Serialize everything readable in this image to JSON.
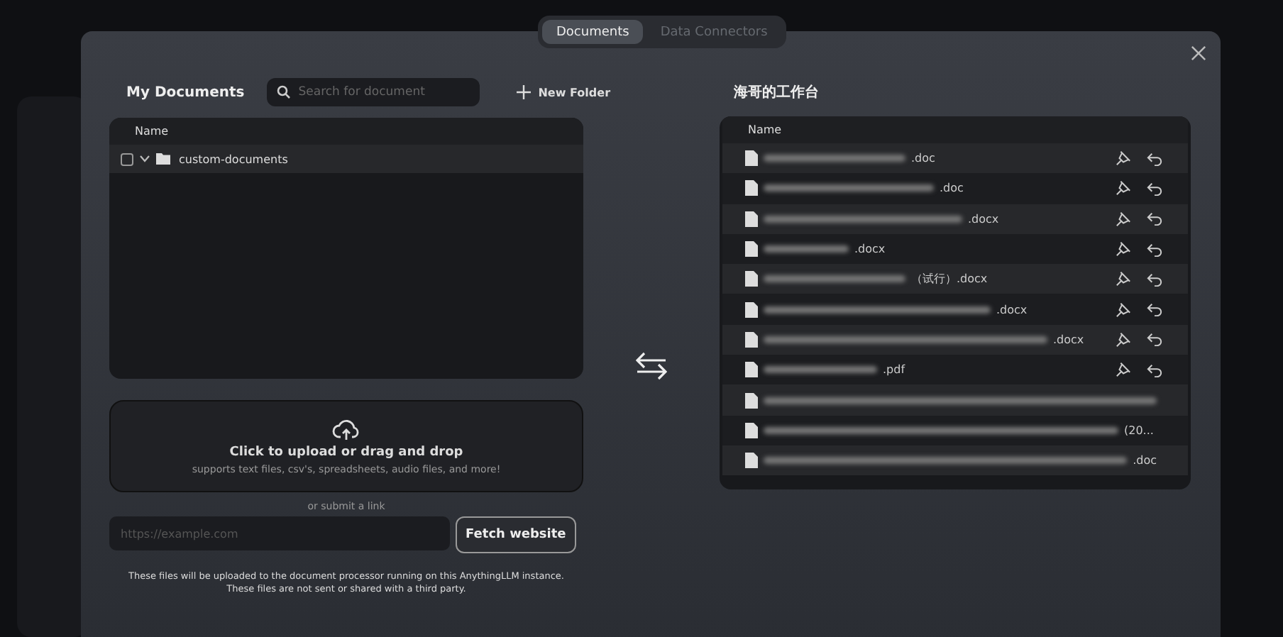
{
  "tabs": [
    {
      "label": "Documents",
      "selected": true
    },
    {
      "label": "Data Connectors",
      "selected": false
    }
  ],
  "my_documents": {
    "title": "My Documents",
    "search": {
      "placeholder": "Search for document"
    },
    "new_folder": "New Folder",
    "table": {
      "column": "Name",
      "rows": [
        {
          "name": "custom-documents",
          "checked": false,
          "expanded": true
        }
      ]
    }
  },
  "upload": {
    "title": "Click to upload or drag and drop",
    "subtitle": "supports text files, csv's, spreadsheets, audio files, and more!",
    "link_hint": "or submit a link",
    "url": {
      "placeholder": "https://example.com"
    },
    "fetch_button": "Fetch website",
    "note": "These files will be uploaded to the document processor running on this AnythingLLM instance.\nThese files are not sent or shared with a third party."
  },
  "workspace": {
    "title": "海哥的工作台",
    "table": {
      "column": "Name",
      "rows": [
        {
          "name": ".doc",
          "actions": true
        },
        {
          "name": ".doc",
          "actions": true
        },
        {
          "name": ".docx",
          "actions": true
        },
        {
          "name": ".docx",
          "actions": true
        },
        {
          "name": "（试行）.docx",
          "actions": true
        },
        {
          "name": ".docx",
          "actions": true
        },
        {
          "name": ".docx",
          "actions": true
        },
        {
          "name": ".pdf",
          "actions": true
        },
        {
          "actions": false
        },
        {
          "name": "(20...",
          "actions": false
        },
        {
          "name": ".doc",
          "actions": false
        }
      ]
    }
  }
}
